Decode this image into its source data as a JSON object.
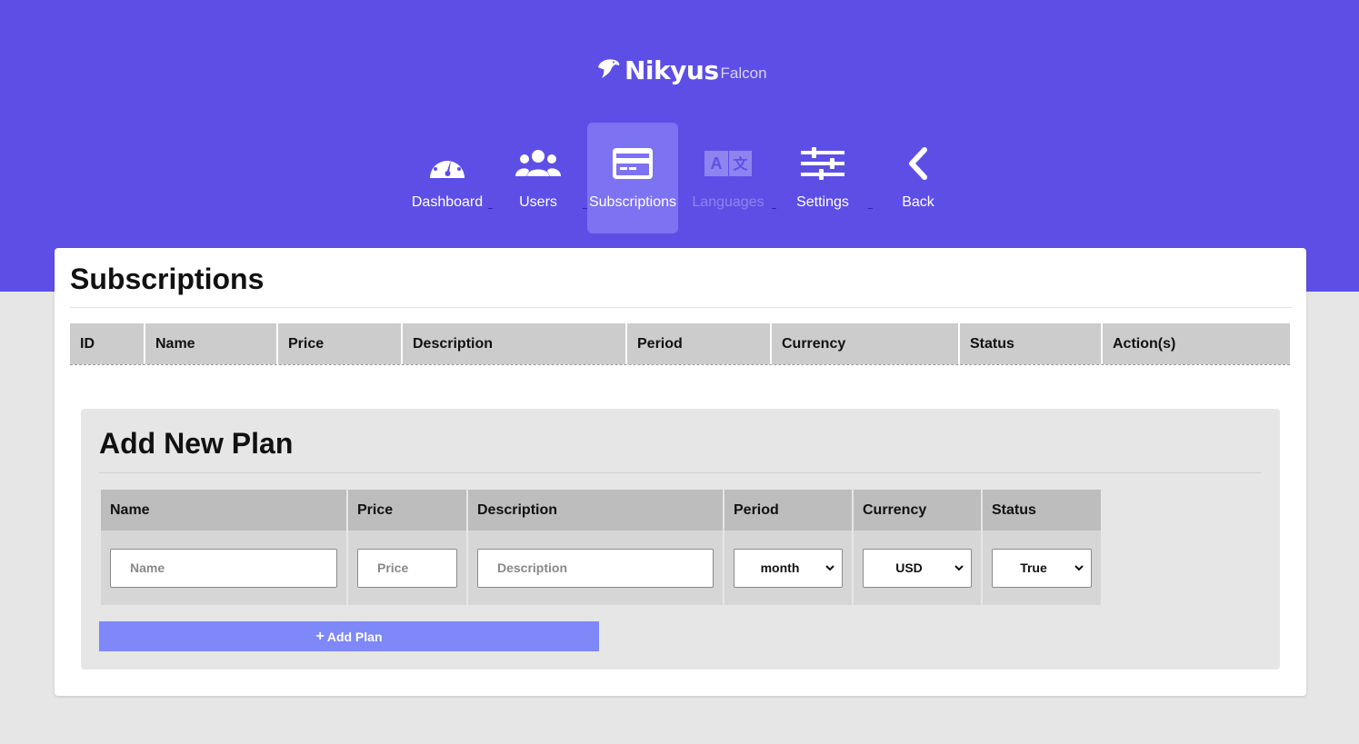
{
  "brand": {
    "name": "Nikyus",
    "sub": "Falcon",
    "icon": "falcon-logo-icon"
  },
  "nav": [
    {
      "label": "Dashboard",
      "icon": "speedometer-icon"
    },
    {
      "label": "Users",
      "icon": "users-icon"
    },
    {
      "label": "Subscriptions",
      "icon": "credit-card-icon",
      "active": true
    },
    {
      "label": "Languages",
      "icon": "translate-icon",
      "disabled": true
    },
    {
      "label": "Settings",
      "icon": "sliders-icon"
    },
    {
      "label": "Back",
      "icon": "chevron-left-icon"
    }
  ],
  "page_title": "Subscriptions",
  "subscriptions_table": {
    "columns": [
      "ID",
      "Name",
      "Price",
      "Description",
      "Period",
      "Currency",
      "Status",
      "Action(s)"
    ],
    "rows": []
  },
  "add_plan": {
    "title": "Add New Plan",
    "columns": [
      "Name",
      "Price",
      "Description",
      "Period",
      "Currency",
      "Status"
    ],
    "name_placeholder": "Name",
    "price_placeholder": "Price",
    "description_placeholder": "Description",
    "period_value": "month",
    "currency_value": "USD",
    "status_value": "True",
    "button_label": "Add Plan",
    "button_icon": "plus-icon"
  },
  "colors": {
    "hero": "#5d4fe5",
    "active_tab": "#7d72f2",
    "button": "#7e88f9",
    "page_bg": "#e6e6e6"
  }
}
